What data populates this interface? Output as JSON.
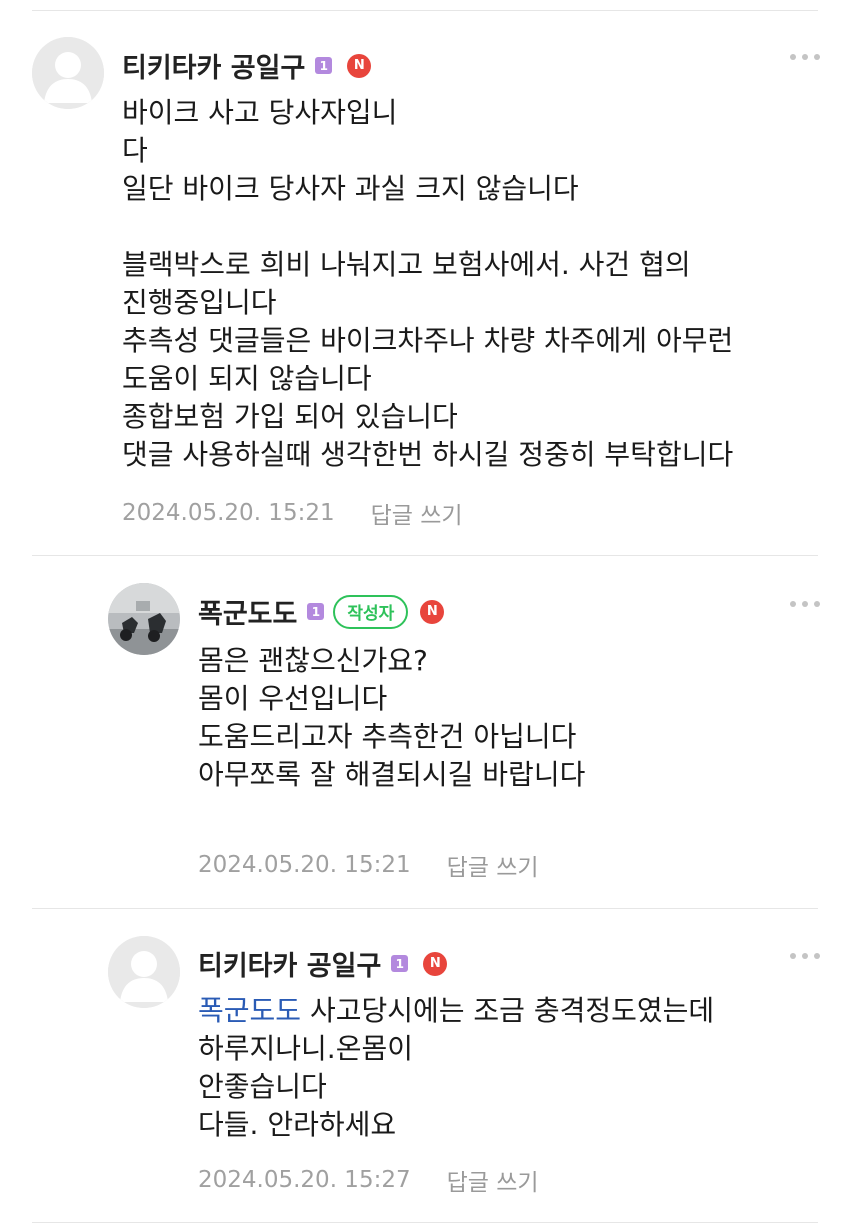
{
  "comments": [
    {
      "nickname": "티키타카 공일구",
      "level_badge": "1",
      "new_badge": "N",
      "lines": [
        "바이크 사고 당사자입니",
        "다",
        "일단 바이크 당사자 과실 크지 않습니다",
        "",
        "블랙박스로 희비 나눠지고 보험사에서. 사건 협의",
        "진행중입니다",
        "추측성 댓글들은 바이크차주나 차량 차주에게 아무런",
        "도움이 되지 않습니다",
        "종합보험 가입 되어 있습니다",
        "댓글 사용하실때 생각한번 하시길 정중히 부탁합니다"
      ],
      "timestamp": "2024.05.20. 15:21",
      "reply_label": "답글 쓰기"
    },
    {
      "nickname": "폭군도도",
      "level_badge": "1",
      "author_tag": "작성자",
      "new_badge": "N",
      "lines": [
        "몸은 괜찮으신가요?",
        "몸이 우선입니다",
        "도움드리고자 추측한건 아닙니다",
        "아무쪼록 잘 해결되시길 바랍니다"
      ],
      "timestamp": "2024.05.20. 15:21",
      "reply_label": "답글 쓰기"
    },
    {
      "nickname": "티키타카 공일구",
      "level_badge": "1",
      "new_badge": "N",
      "mention": "폭군도도",
      "lines": [
        "사고당시에는 조금 충격정도였는데",
        "하루지나니.온몸이",
        "안좋습니다",
        "다들. 안라하세요"
      ],
      "timestamp": "2024.05.20. 15:27",
      "reply_label": "답글 쓰기"
    }
  ],
  "colors": {
    "level_badge": "#b389de",
    "new_badge": "#e8453c",
    "author_tag": "#2ec25a",
    "mention": "#2a5bb5",
    "timestamp": "#a0a0a0"
  },
  "icons": [
    "more-options-icon",
    "default-avatar-icon",
    "motorcycle-photo-avatar"
  ]
}
